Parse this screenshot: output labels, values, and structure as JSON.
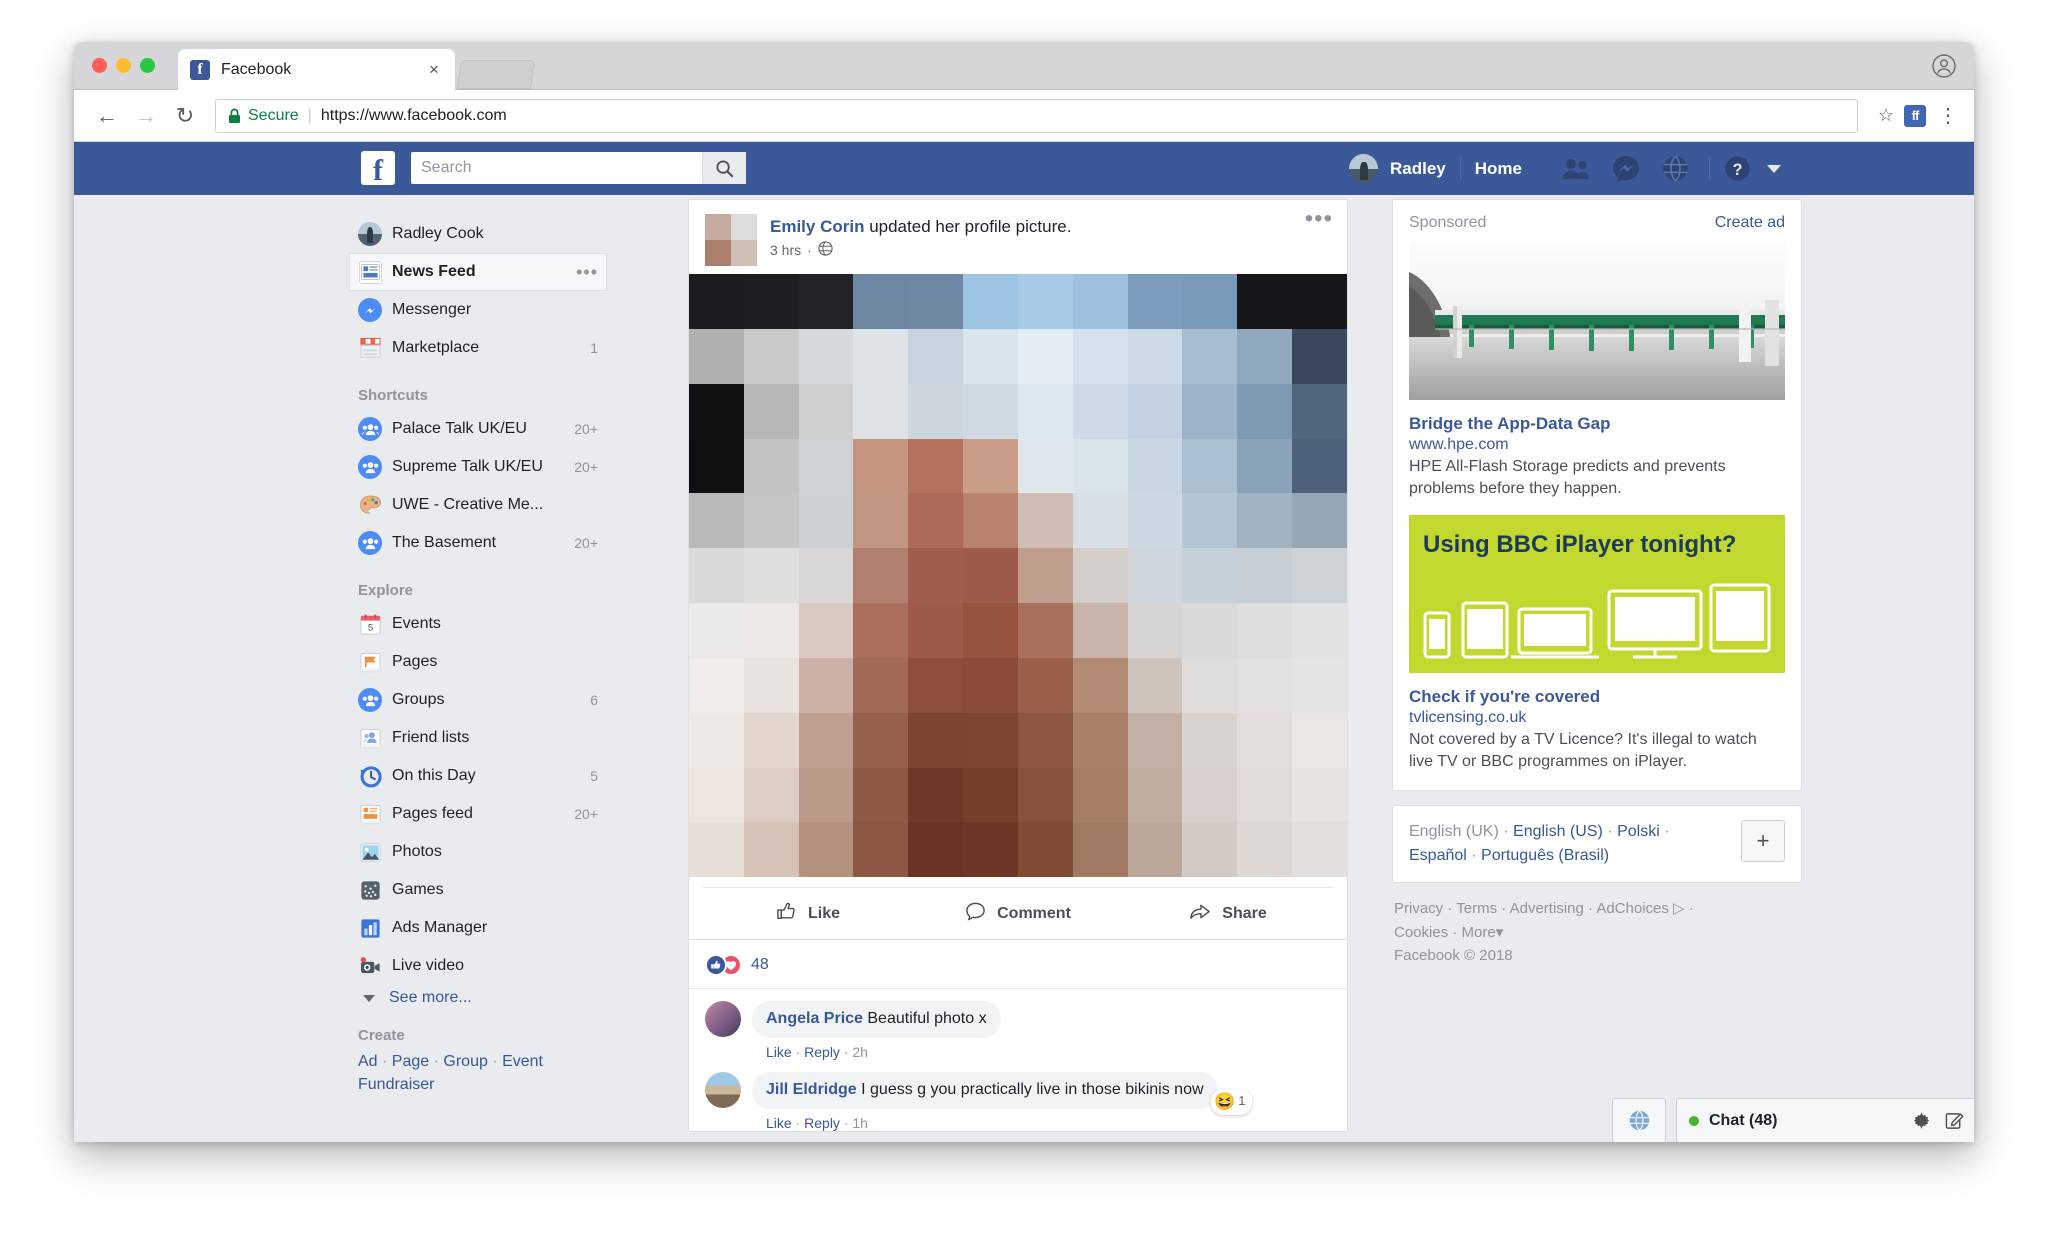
{
  "browser": {
    "tab": {
      "title": "Facebook",
      "favicon": "facebook-favicon",
      "close": "×"
    },
    "address": {
      "secure_label": "Secure",
      "url": "https://www.facebook.com",
      "back": "←",
      "forward": "→",
      "reload": "↻",
      "star": "☆",
      "extension": "ff",
      "menu": "⋮"
    }
  },
  "topbar": {
    "logo": "f",
    "search_placeholder": "Search",
    "search_value": "",
    "user_name": "Radley",
    "home_label": "Home",
    "icons": [
      "friend-requests-icon",
      "messenger-icon",
      "notifications-globe-icon",
      "help-icon",
      "account-caret-icon"
    ]
  },
  "sidebar": {
    "profile": {
      "label": "Radley Cook"
    },
    "primary": [
      {
        "label": "News Feed",
        "badge": "",
        "icon": "news-feed-icon",
        "active": true,
        "menu": "•••"
      },
      {
        "label": "Messenger",
        "badge": "",
        "icon": "messenger-icon",
        "active": false
      },
      {
        "label": "Marketplace",
        "badge": "1",
        "icon": "marketplace-icon",
        "active": false
      }
    ],
    "shortcuts_header": "Shortcuts",
    "shortcuts": [
      {
        "label": "Palace Talk UK/EU",
        "badge": "20+",
        "icon": "group-icon"
      },
      {
        "label": "Supreme Talk UK/EU",
        "badge": "20+",
        "icon": "group-icon"
      },
      {
        "label": "UWE - Creative Me...",
        "badge": "",
        "icon": "palette-icon"
      },
      {
        "label": "The Basement",
        "badge": "20+",
        "icon": "group-icon"
      }
    ],
    "explore_header": "Explore",
    "explore": [
      {
        "label": "Events",
        "badge": "",
        "icon": "calendar-icon"
      },
      {
        "label": "Pages",
        "badge": "",
        "icon": "flag-icon"
      },
      {
        "label": "Groups",
        "badge": "6",
        "icon": "group-icon"
      },
      {
        "label": "Friend lists",
        "badge": "",
        "icon": "friend-lists-icon"
      },
      {
        "label": "On this Day",
        "badge": "5",
        "icon": "clock-history-icon"
      },
      {
        "label": "Pages feed",
        "badge": "20+",
        "icon": "pages-feed-icon"
      },
      {
        "label": "Photos",
        "badge": "",
        "icon": "photos-icon"
      },
      {
        "label": "Games",
        "badge": "",
        "icon": "games-icon"
      },
      {
        "label": "Ads Manager",
        "badge": "",
        "icon": "ads-manager-icon"
      },
      {
        "label": "Live video",
        "badge": "",
        "icon": "live-video-icon"
      }
    ],
    "see_more": "See more...",
    "create_header": "Create",
    "create_links": [
      "Ad",
      "Page",
      "Group",
      "Event",
      "Fundraiser"
    ]
  },
  "post": {
    "author": "Emily Corin",
    "action": " updated her profile picture.",
    "time": "3 hrs",
    "privacy_icon": "globe-privacy-icon",
    "menu_icon": "post-options-icon",
    "actions": [
      {
        "label": "Like",
        "icon": "thumbs-up-icon"
      },
      {
        "label": "Comment",
        "icon": "comment-bubble-icon"
      },
      {
        "label": "Share",
        "icon": "share-arrow-icon"
      }
    ],
    "reaction_count": "48",
    "comments": [
      {
        "author": "Angela Price",
        "text": " Beautiful photo x",
        "like": "Like",
        "reply": "Reply",
        "time": "2h",
        "emoji": "",
        "emoji_count": ""
      },
      {
        "author": "Jill Eldridge",
        "text": " I guess g you practically live in those bikinis now",
        "like": "Like",
        "reply": "Reply",
        "time": "1h",
        "emoji": "😆",
        "emoji_count": "1"
      }
    ]
  },
  "ads": {
    "sponsored_label": "Sponsored",
    "create_ad_label": "Create ad",
    "items": [
      {
        "title": "Bridge the App-Data Gap",
        "url": "www.hpe.com",
        "desc": "HPE All-Flash Storage predicts and prevents problems before they happen.",
        "image": "bridge-photo"
      },
      {
        "title": "Check if you're covered",
        "url": "tvlicensing.co.uk",
        "desc": "Not covered by a TV Licence? It's illegal to watch live TV or BBC programmes on iPlayer.",
        "image": "bbc-iplayer-banner",
        "banner_text": "Using BBC iPlayer tonight?"
      }
    ]
  },
  "languages": {
    "items": [
      "English (UK)",
      "English (US)",
      "Polski",
      "Español",
      "Português (Brasil)"
    ],
    "plus": "+"
  },
  "footer": {
    "links": [
      "Privacy",
      "Terms",
      "Advertising",
      "AdChoices",
      "Cookies",
      "More"
    ],
    "copyright": "Facebook © 2018"
  },
  "chat": {
    "title": "Chat (48)",
    "globe_icon": "globe-icon",
    "icons": [
      "gear-icon",
      "compose-icon",
      "friend-list-icon"
    ]
  },
  "photo_pixels": [
    [
      "#1c1c20",
      "#1f1f23",
      "#222228",
      "#6d87a3",
      "#6e88a4",
      "#9ec4e4",
      "#a8cbe8",
      "#9dc1df",
      "#7b9cbd",
      "#7a9ab9",
      "#16161a",
      "#16161a"
    ],
    [
      "#b0b0b0",
      "#c9c9c9",
      "#d4d9dd",
      "#dde3e7",
      "#c7d4de",
      "#d9e4ec",
      "#e4edf3",
      "#d5e2ec",
      "#cddbe7",
      "#a8bed0",
      "#8fa8bd",
      "#3a4a5c"
    ],
    [
      "#111114",
      "#b7b7b7",
      "#cfcfcf",
      "#dfe3e6",
      "#cdd6dd",
      "#cfd9e1",
      "#dde7ef",
      "#cfdae4",
      "#c2d2e0",
      "#9db4c8",
      "#7e9ab2",
      "#50677d"
    ],
    [
      "#0f0f12",
      "#c4c4c4",
      "#ccd2d6",
      "#c5957f",
      "#b6705e",
      "#c99d87",
      "#dfe7ed",
      "#d9e3ea",
      "#c9d7e3",
      "#aabfd0",
      "#8ba3b8",
      "#4d627a"
    ],
    [
      "#b9b9b9",
      "#c6c6c6",
      "#cdd1d4",
      "#c09682",
      "#ad6a59",
      "#b9826d",
      "#d0bdb3",
      "#d8dfe5",
      "#cdd9e2",
      "#b4c6d4",
      "#9fb3c3",
      "#93a7b7"
    ],
    [
      "#dadada",
      "#dedede",
      "#d9d7d6",
      "#b07f6d",
      "#a05c4d",
      "#9e5a4b",
      "#c09e8e",
      "#d5cfcc",
      "#cfd6dc",
      "#c6d0d8",
      "#c8cfd4",
      "#ccd2d6"
    ],
    [
      "#eceae9",
      "#ece9e7",
      "#d9c9c2",
      "#a96f5c",
      "#9e5b4a",
      "#96543f",
      "#a9705c",
      "#c9b4a9",
      "#d6d5d4",
      "#dadada",
      "#dededd",
      "#e2e2e2"
    ],
    [
      "#efece9",
      "#e9e3e0",
      "#cbb1a6",
      "#a06a56",
      "#8d4f3d",
      "#8a4c38",
      "#9a6049",
      "#b38a74",
      "#cfc4bc",
      "#dedcdb",
      "#e3e1e0",
      "#e6e4e3"
    ],
    [
      "#efe9e5",
      "#e3d6cf",
      "#bf9f91",
      "#95604c",
      "#7d4430",
      "#7e4631",
      "#8d5640",
      "#a87f67",
      "#c2b0a4",
      "#d9d3cf",
      "#e3dedb",
      "#e8e5e3"
    ],
    [
      "#ece4df",
      "#ddcdc4",
      "#bb9a8a",
      "#8e5a46",
      "#6e3a28",
      "#734029",
      "#87523b",
      "#a77f66",
      "#c0ada0",
      "#d6cfcb",
      "#e0dbd8",
      "#e6e3e1"
    ],
    [
      "#e8ded8",
      "#d6c3b8",
      "#b4907f",
      "#8b5743",
      "#663325",
      "#6b3826",
      "#7f4b35",
      "#a07962",
      "#bca89a",
      "#d2cac5",
      "#ddd8d4",
      "#e3dfdd"
    ]
  ]
}
